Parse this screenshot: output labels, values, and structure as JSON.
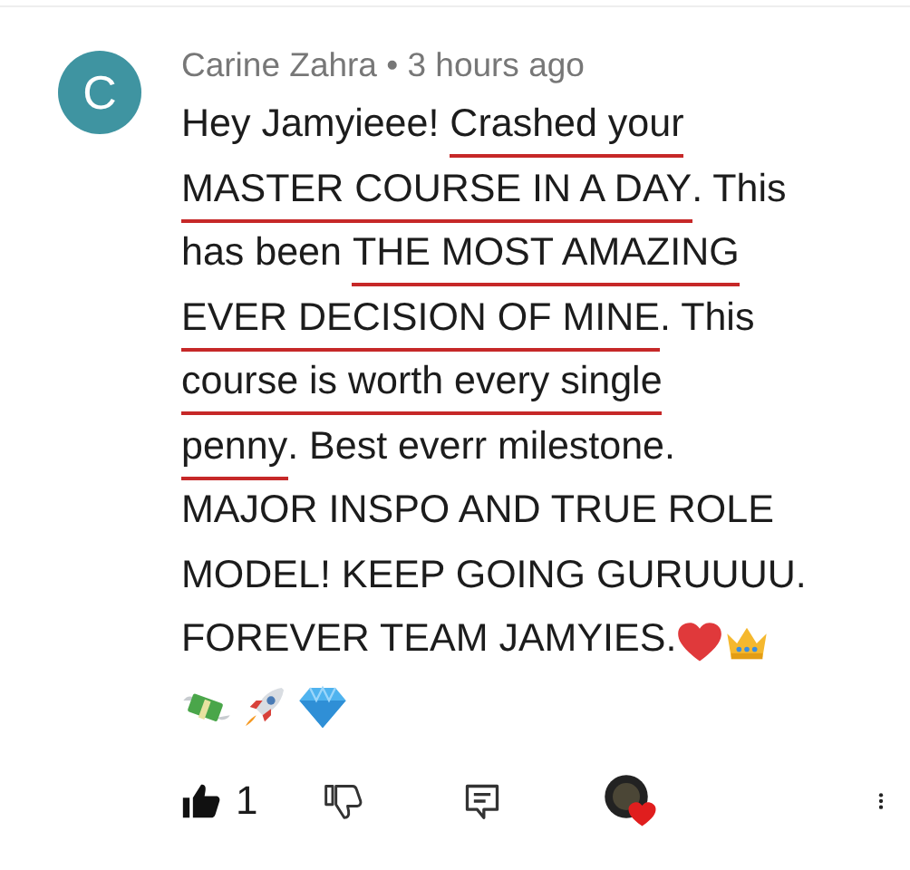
{
  "comment": {
    "avatar_letter": "C",
    "author": "Carine Zahra",
    "separator": "•",
    "time": "3 hours ago",
    "lines": [
      {
        "segments": [
          {
            "text": "Hey Jamyieee! ",
            "underlined": false
          },
          {
            "text": "Crashed your",
            "underlined": true
          }
        ]
      },
      {
        "segments": [
          {
            "text": "MASTER COURSE IN A DAY",
            "underlined": true
          },
          {
            "text": ". This",
            "underlined": false
          }
        ]
      },
      {
        "segments": [
          {
            "text": "has been ",
            "underlined": false
          },
          {
            "text": "THE MOST AMAZING",
            "underlined": true
          }
        ]
      },
      {
        "segments": [
          {
            "text": "EVER DECISION OF MINE",
            "underlined": true
          },
          {
            "text": ". This",
            "underlined": false
          }
        ]
      },
      {
        "segments": [
          {
            "text": "course is worth every single",
            "underlined": true
          }
        ]
      },
      {
        "segments": [
          {
            "text": "penny",
            "underlined": true
          },
          {
            "text": ". Best everr milestone.",
            "underlined": false
          }
        ]
      },
      {
        "segments": [
          {
            "text": "MAJOR INSPO AND TRUE ROLE",
            "underlined": false
          }
        ]
      },
      {
        "segments": [
          {
            "text": "MODEL! KEEP GOING GURUUUU.",
            "underlined": false
          }
        ]
      },
      {
        "segments": [
          {
            "text": "FOREVER TEAM JAMYIES.",
            "underlined": false
          }
        ],
        "emojis": [
          {
            "kind": "heart"
          },
          {
            "kind": "crown"
          }
        ]
      }
    ],
    "emoji_line": [
      {
        "kind": "money"
      },
      {
        "kind": "rocket"
      },
      {
        "kind": "gem"
      }
    ],
    "likes": "1",
    "liked": true,
    "creator_hearted": true
  }
}
